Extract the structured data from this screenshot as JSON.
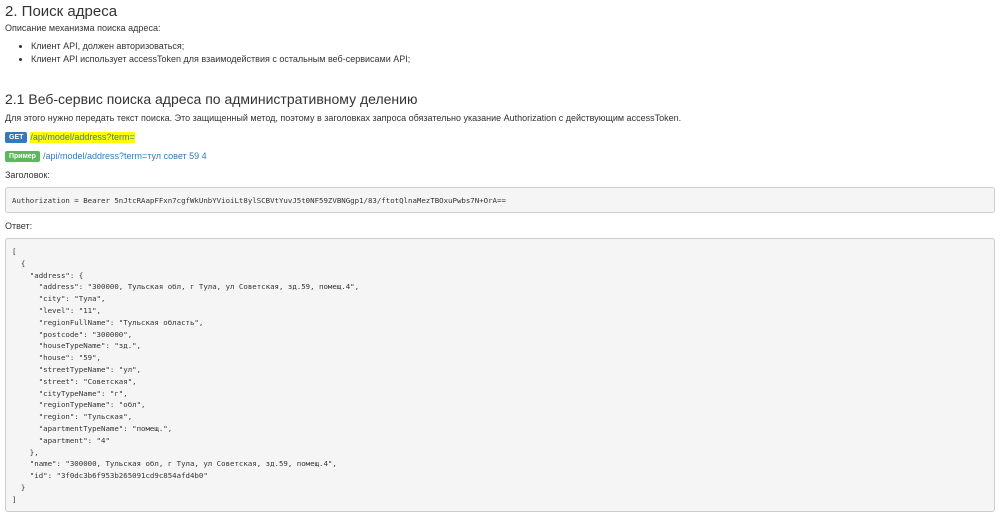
{
  "section": {
    "title": "2. Поиск адреса",
    "description": "Описание механизма поиска адреса:",
    "bullets": [
      "Клиент API, должен авторизоваться;",
      "Клиент API использует accessToken для взаимодействия с остальным веб-сервисами API;"
    ]
  },
  "subsection": {
    "title": "2.1 Веб-сервис поиска адреса по административному делению",
    "description": "Для этого нужно передать текст поиска. Это защищенный метод, поэтому в заголовках запроса обязательно указание Authorization с действующим accessToken.",
    "get_badge": "GET",
    "endpoint": "/api/model/address?term=",
    "example_badge": "Пример",
    "example_link": "/api/model/address?term=тул совет 59 4",
    "headers_label": "Заголовок:",
    "headers_code": "Authorization = Bearer 5nJtcRAapFFxn7cgfWkUnbYVioiLt8ylSCBVtYuvJ5t0NF59ZVBNGgp1/83/ftotQlnaMezTBOxuPwbs7N+OrA==",
    "response_label": "Ответ:",
    "response_code": "[\n  {\n    \"address\": {\n      \"address\": \"300000, Тульская обл, г Тула, ул Советская, зд.59, помещ.4\",\n      \"city\": \"Тула\",\n      \"level\": \"11\",\n      \"regionFullName\": \"Тульская область\",\n      \"postcode\": \"300000\",\n      \"houseTypeName\": \"зд.\",\n      \"house\": \"59\",\n      \"streetTypeName\": \"ул\",\n      \"street\": \"Советская\",\n      \"cityTypeName\": \"г\",\n      \"regionTypeName\": \"обл\",\n      \"region\": \"Тульская\",\n      \"apartmentTypeName\": \"помещ.\",\n      \"apartment\": \"4\"\n    },\n    \"name\": \"300000, Тульская обл, г Тула, ул Советская, зд.59, помещ.4\",\n    \"id\": \"3f0dc3b6f953b265091cd9c854afd4b0\"\n  }\n]"
  }
}
